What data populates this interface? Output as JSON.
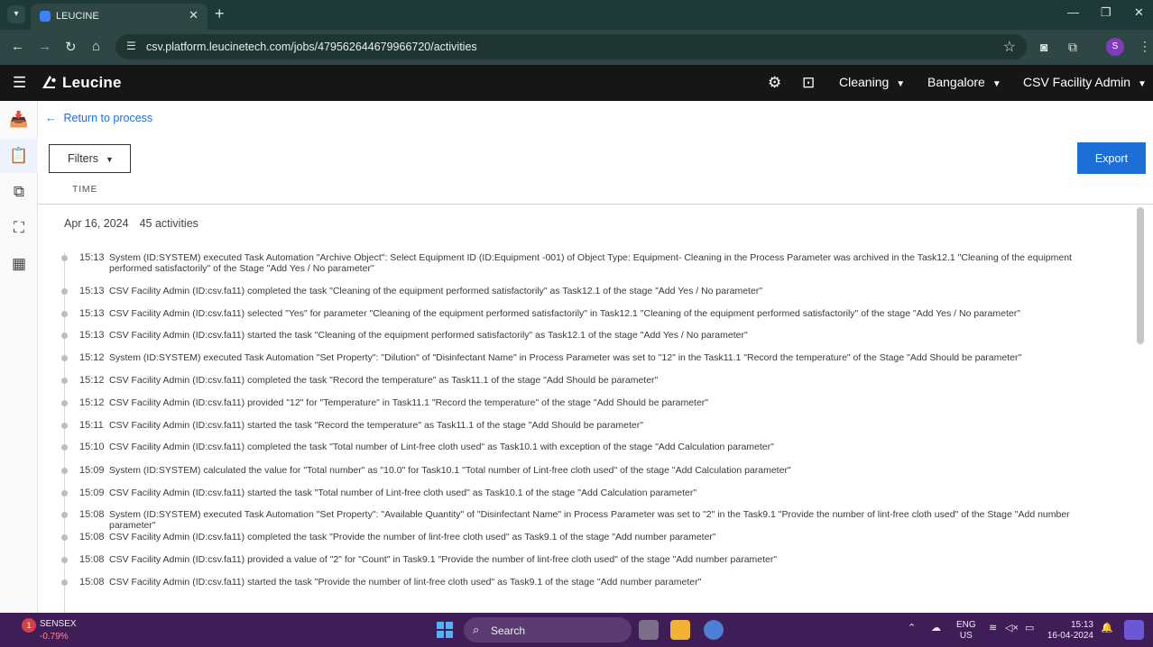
{
  "browser": {
    "tab_title": "LEUCINE",
    "url": "csv.platform.leucinetech.com/jobs/479562644679966720/activities",
    "profile_initial": "S"
  },
  "header": {
    "brand": "Leucine",
    "use_case": "Cleaning",
    "facility": "Bangalore",
    "user_role": "CSV Facility Admin"
  },
  "toolbar": {
    "back_label": "Return to process",
    "filters_label": "Filters",
    "export_label": "Export",
    "time_column": "TIME"
  },
  "activity_group": {
    "date": "Apr 16, 2024",
    "count_label": "45 activities"
  },
  "activities": [
    {
      "time": "15:13",
      "text": "System (ID:SYSTEM) executed Task Automation \"Archive Object\": Select Equipment ID (ID:Equipment -001) of Object Type: Equipment- Cleaning in the Process Parameter was archived in the Task12.1 \"Cleaning of the equipment performed satisfactorily\" of the Stage \"Add Yes / No parameter\""
    },
    {
      "time": "15:13",
      "text": "CSV Facility Admin (ID:csv.fa11) completed the task \"Cleaning of the equipment performed satisfactorily\" as Task12.1 of the stage \"Add Yes / No parameter\""
    },
    {
      "time": "15:13",
      "text": "CSV Facility Admin (ID:csv.fa11) selected \"Yes\" for parameter \"Cleaning of the equipment performed satisfactorily\" in Task12.1 \"Cleaning of the equipment performed satisfactorily\" of the stage \"Add Yes / No parameter\""
    },
    {
      "time": "15:13",
      "text": "CSV Facility Admin (ID:csv.fa11) started the task \"Cleaning of the equipment performed satisfactorily\" as Task12.1 of the stage \"Add Yes / No parameter\""
    },
    {
      "time": "15:12",
      "text": "System (ID:SYSTEM) executed Task Automation \"Set Property\": \"Dilution\" of \"Disinfectant Name\" in Process Parameter was set to \"12\" in the Task11.1 \"Record the temperature\" of the Stage \"Add Should be parameter\""
    },
    {
      "time": "15:12",
      "text": "CSV Facility Admin (ID:csv.fa11) completed the task \"Record the temperature\" as Task11.1 of the stage \"Add Should be parameter\""
    },
    {
      "time": "15:12",
      "text": "CSV Facility Admin (ID:csv.fa11) provided \"12\" for \"Temperature\" in Task11.1 \"Record the temperature\" of the stage \"Add Should be parameter\""
    },
    {
      "time": "15:11",
      "text": "CSV Facility Admin (ID:csv.fa11) started the task \"Record the temperature\" as Task11.1 of the stage \"Add Should be parameter\""
    },
    {
      "time": "15:10",
      "text": "CSV Facility Admin (ID:csv.fa11) completed the task \"Total number of Lint-free cloth used\" as Task10.1 with exception of the stage \"Add Calculation parameter\""
    },
    {
      "time": "15:09",
      "text": "System (ID:SYSTEM) calculated the value for \"Total number\" as \"10.0\" for Task10.1 \"Total number of Lint-free cloth used\" of the stage \"Add Calculation parameter\""
    },
    {
      "time": "15:09",
      "text": "CSV Facility Admin (ID:csv.fa11) started the task \"Total number of Lint-free cloth used\" as Task10.1 of the stage \"Add Calculation parameter\""
    },
    {
      "time": "15:08",
      "text": "System (ID:SYSTEM) executed Task Automation \"Set Property\": \"Available Quantity\" of \"Disinfectant Name\" in Process Parameter was set to \"2\" in the Task9.1 \"Provide the number of lint-free cloth used\" of the Stage \"Add number parameter\""
    },
    {
      "time": "15:08",
      "text": "CSV Facility Admin (ID:csv.fa11) completed the task \"Provide the number of lint-free cloth used\" as Task9.1 of the stage \"Add number parameter\""
    },
    {
      "time": "15:08",
      "text": "CSV Facility Admin (ID:csv.fa11) provided a value of \"2\" for \"Count\" in Task9.1 \"Provide the number of lint-free cloth used\" of the stage \"Add number parameter\""
    },
    {
      "time": "15:08",
      "text": "CSV Facility Admin (ID:csv.fa11) started the task \"Provide the number of lint-free cloth used\" as Task9.1 of the stage \"Add number parameter\""
    }
  ],
  "taskbar": {
    "sensex_label": "SENSEX",
    "sensex_change": "-0.79%",
    "sensex_badge": "1",
    "search_label": "Search",
    "lang_1": "ENG",
    "lang_2": "US",
    "time": "15:13",
    "date": "16-04-2024"
  },
  "colors": {
    "accent": "#1d6fd8",
    "header_bg": "#161616",
    "taskbar_bg": "#3f1d57"
  }
}
